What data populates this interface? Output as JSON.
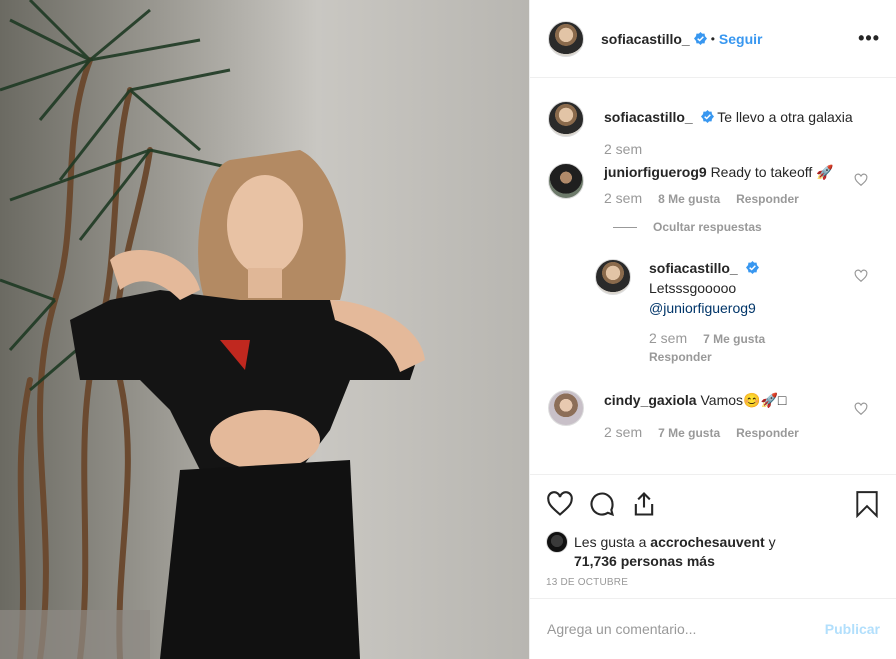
{
  "header": {
    "username": "sofiacastillo_",
    "separator": "•",
    "follow_label": "Seguir",
    "more_label": "•••"
  },
  "comments": [
    {
      "username": "sofiacastillo_",
      "text": "Te llevo a otra galaxia",
      "time": "2 sem",
      "verified": true
    },
    {
      "username": "juniorfiguerog9",
      "text": "Ready to takeoff 🚀",
      "time": "2 sem",
      "likes": "8 Me gusta",
      "reply_label": "Responder"
    },
    {
      "hide_replies": "Ocultar respuestas"
    },
    {
      "username": "sofiacastillo_",
      "text": "Letsssgooooo",
      "mention": "@juniorfiguerog9",
      "time": "2 sem",
      "likes": "7 Me gusta",
      "reply_label": "Responder",
      "verified": true
    },
    {
      "username": "cindy_gaxiola",
      "text": "Vamos😊🚀□",
      "time": "2 sem",
      "likes": "7 Me gusta",
      "reply_label": "Responder"
    }
  ],
  "likes": {
    "prefix": "Les gusta a",
    "user": "accrochesauvent",
    "middle": "y",
    "count": "71,736 personas más"
  },
  "date": "13 DE OCTUBRE",
  "add_comment": {
    "placeholder": "Agrega un comentario...",
    "publish_label": "Publicar"
  },
  "colors": {
    "link": "#3897f0",
    "publish_disabled": "#b2dffc",
    "secondary": "#999999"
  }
}
